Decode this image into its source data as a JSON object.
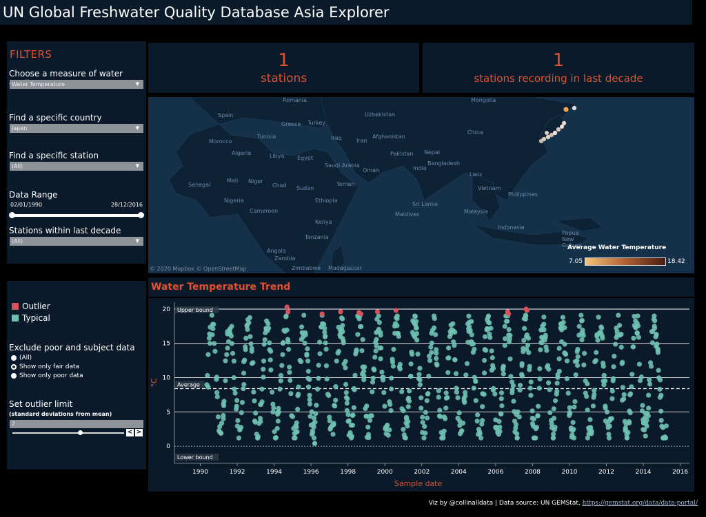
{
  "title": "UN Global Freshwater Quality Database Asia Explorer",
  "filters": {
    "heading": "FILTERS",
    "measure_label": "Choose a measure of water quality",
    "measure_value": "Water Temperature",
    "country_label": "Find a specific country",
    "country_value": "Japan",
    "station_label": "Find a specific station",
    "station_value": "(All)",
    "range_label": "Data Range",
    "range_start": "02/01/1990",
    "range_end": "28/12/2016",
    "decade_label": "Stations within last decade",
    "decade_value": "(All)"
  },
  "kpis": [
    {
      "value": "1",
      "label": "stations"
    },
    {
      "value": "1",
      "label": "stations recording in last decade"
    }
  ],
  "map": {
    "attribution": "© 2020 Mapbox © OpenStreetMap",
    "legend_title": "Average Water Temperature",
    "legend_min": "7.05",
    "legend_max": "18.42",
    "labels": [
      "Romania",
      "Mongolia",
      "Spain",
      "Greece",
      "Turkey",
      "Uzbekistan",
      "Morocco",
      "Tunisia",
      "Iraq",
      "Iran",
      "Afghanistan",
      "China",
      "Algeria",
      "Libya",
      "Egypt",
      "Pakistan",
      "Nepal",
      "Saudi Arabia",
      "Bangladesh",
      "Oman",
      "India",
      "Senegal",
      "Mali",
      "Niger",
      "Chad",
      "Sudan",
      "Yemen",
      "Laos",
      "Vietnam",
      "Nigeria",
      "Ethiopia",
      "Philippines",
      "Cameroon",
      "Sri Lanka",
      "Malaysia",
      "Maldives",
      "Kenya",
      "Indonesia",
      "Papua New Guinea",
      "Tanzania",
      "Angola",
      "Zambia",
      "Zimbabwe",
      "Madagascar"
    ]
  },
  "legend": {
    "outlier": "Outlier",
    "typical": "Typical",
    "outlier_color": "#d8525c",
    "typical_color": "#6fc1b3",
    "exclude_label": "Exclude poor and subject data",
    "options": [
      "(All)",
      "Show only fair data",
      "Show only poor data"
    ],
    "selected_option": "Show only fair data",
    "outlier_limit_label": "Set outlier limit",
    "outlier_limit_sub": "(standard deviations from mean)",
    "outlier_limit_value": "2"
  },
  "trend": {
    "title": "Water Temperature Trend"
  },
  "chart_data": {
    "type": "scatter",
    "xlabel": "Sample date",
    "ylabel": "°C",
    "xlim": [
      1988.6,
      2016.5
    ],
    "ylim": [
      -2.5,
      21
    ],
    "xticks": [
      1990,
      1992,
      1994,
      1996,
      1998,
      2000,
      2002,
      2004,
      2006,
      2008,
      2010,
      2012,
      2014,
      2016
    ],
    "yticks": [
      0,
      5,
      10,
      15,
      20
    ],
    "reference_lines": [
      {
        "label": "Upper bound",
        "value": 20
      },
      {
        "label": "Average",
        "value": 8.4
      },
      {
        "label": "Lower bound",
        "value": 0
      }
    ],
    "series": [
      {
        "name": "Typical",
        "color": "#6fc1b3",
        "note": "monthly samples 1990–2015 cycling seasonally between ~1.5 and ~19 °C"
      },
      {
        "name": "Outlier",
        "color": "#d8525c",
        "points": [
          [
            1994.7,
            20.3
          ],
          [
            1994.75,
            19.6
          ],
          [
            1996.6,
            19.3
          ],
          [
            1997.6,
            19.6
          ],
          [
            1998.6,
            19.5
          ],
          [
            1998.7,
            19.3
          ],
          [
            1999.6,
            19.6
          ],
          [
            2000.6,
            19.8
          ],
          [
            2006.65,
            19.6
          ],
          [
            2006.7,
            19.3
          ],
          [
            2007.65,
            20.0
          ],
          [
            2007.7,
            19.8
          ]
        ]
      }
    ]
  },
  "footer": {
    "credit": "Viz by @collinalldata | Data source: UN GEMStat,",
    "link": "https://gemstat.org/data/data-portal/"
  }
}
